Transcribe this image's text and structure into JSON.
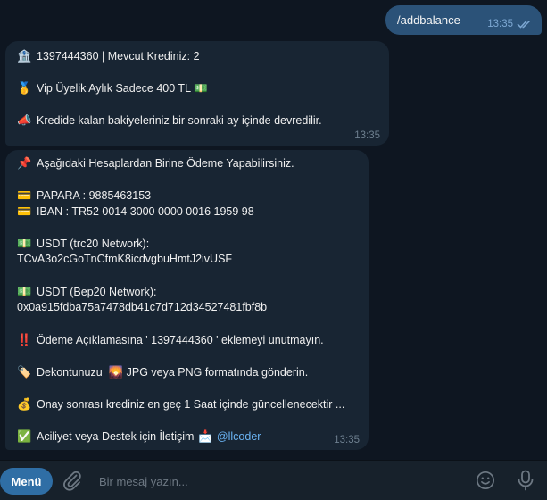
{
  "outgoing": {
    "text": "/addbalance",
    "time": "13:35"
  },
  "message1": {
    "time": "13:35",
    "lines": [
      {
        "emoji": "🏦",
        "text": "1397444360 | Mevcut Krediniz: 2"
      },
      {
        "emoji": "🥇",
        "text": "Vip Üyelik Aylık Sadece 400 TL 💵"
      },
      {
        "emoji": "📣",
        "text": "Kredide kalan bakiyeleriniz bir sonraki ay içinde devredilir."
      }
    ]
  },
  "message2": {
    "time": "13:35",
    "header": {
      "emoji": "📌",
      "text": "Aşağıdaki Hesaplardan Birine Ödeme Yapabilirsiniz."
    },
    "papara": {
      "emoji": "💳",
      "text": "PAPARA : 9885463153"
    },
    "iban": {
      "emoji": "💳",
      "text": "IBAN : TR52 0014 3000 0000 0016 1959 98"
    },
    "usdt_trc": {
      "emoji": "💵",
      "label": "USDT (trc20 Network):",
      "address": "TCvA3o2cGoTnCfmK8icdvgbuHmtJ2ivUSF"
    },
    "usdt_bep": {
      "emoji": "💵",
      "label": "USDT (Bep20 Network):",
      "address": "0x0a915fdba75a7478db41c7d712d34527481fbf8b"
    },
    "warning": {
      "emoji": "‼️",
      "text": "Ödeme Açıklamasına ' 1397444360 ' eklemeyi unutmayın."
    },
    "receipt": {
      "emoji": "🏷️",
      "text_before": "Dekontunuzu ",
      "emoji2": "🌄",
      "text_after": " JPG veya PNG formatında gönderin."
    },
    "approval": {
      "emoji": "💰",
      "text": "Onay sonrası krediniz en geç 1 Saat içinde güncellenecektir ..."
    },
    "support": {
      "emoji": "✅",
      "text": "Aciliyet veya Destek için İletişim ",
      "emoji2": "📩",
      "link": "@llcoder"
    }
  },
  "composer": {
    "menu_label": "Menü",
    "placeholder": "Bir mesaj yazın..."
  },
  "icons": {
    "attach": "paperclip-icon",
    "emoji": "smiley-icon",
    "mic": "microphone-icon",
    "read": "double-check-icon"
  },
  "colors": {
    "background": "#0e1621",
    "incoming": "#182533",
    "outgoing": "#2b5278",
    "accent": "#2f6ea5",
    "link": "#6ab3f3"
  }
}
